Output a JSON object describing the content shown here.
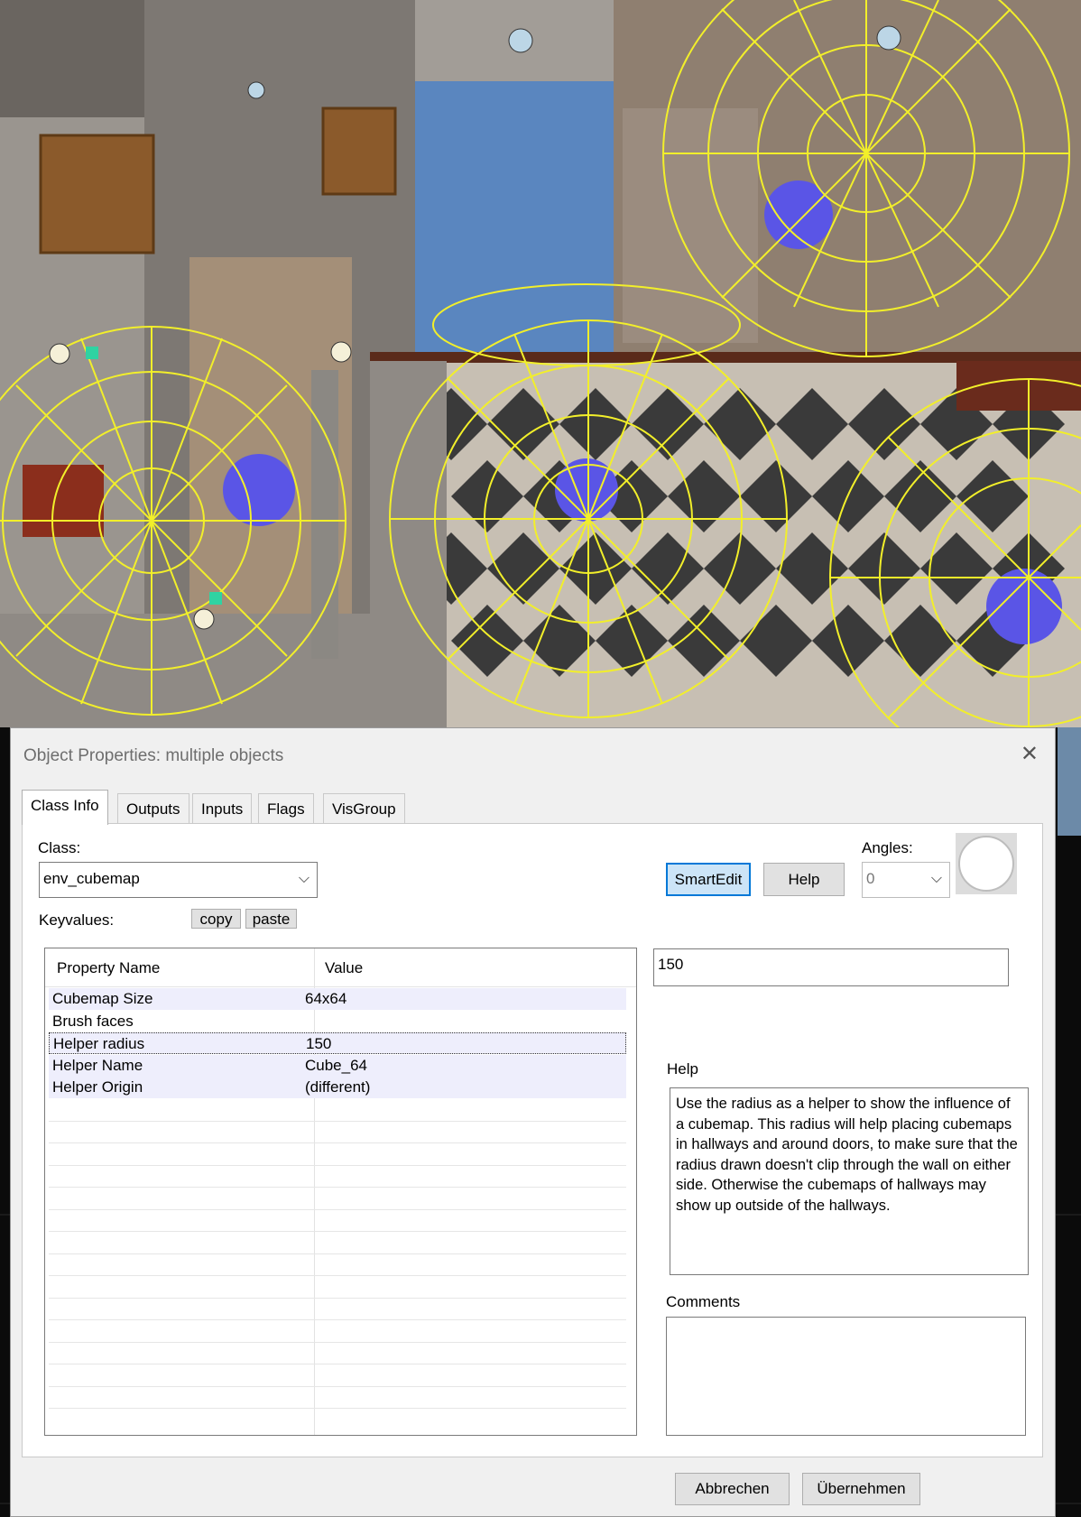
{
  "dialog": {
    "title": "Object Properties: multiple objects",
    "close_icon": "close-icon",
    "tabs": [
      {
        "label": "Class Info",
        "active": true
      },
      {
        "label": "Outputs",
        "active": false
      },
      {
        "label": "Inputs",
        "active": false
      },
      {
        "label": "Flags",
        "active": false
      },
      {
        "label": "VisGroup",
        "active": false
      }
    ],
    "class_label": "Class:",
    "class_value": "env_cubemap",
    "keyvalues_label": "Keyvalues:",
    "copy_label": "copy",
    "paste_label": "paste",
    "smartedit_label": "SmartEdit",
    "help_button_label": "Help",
    "angles_label": "Angles:",
    "angles_value": "0",
    "table": {
      "col_name": "Property Name",
      "col_value": "Value",
      "rows": [
        {
          "name": "Cubemap Size",
          "value": "64x64",
          "highlighted": true
        },
        {
          "name": "Brush faces",
          "value": "",
          "highlighted": false
        },
        {
          "name": "Helper radius",
          "value": "150",
          "highlighted": true,
          "focused": true
        },
        {
          "name": "Helper Name",
          "value": "Cube_64",
          "highlighted": true
        },
        {
          "name": "Helper Origin",
          "value": "(different)",
          "highlighted": true
        }
      ]
    },
    "value_input": "150",
    "help_title": "Help",
    "help_text": "Use the radius as a helper to show the influence of a cubemap. This radius will help placing cubemaps in hallways and around doors, to make sure that the radius drawn doesn't clip through the wall on either side. Otherwise the cubemaps of hallways may show up outside of the hallways.",
    "comments_label": "Comments",
    "comments_value": "",
    "cancel_label": "Abbrechen",
    "apply_label": "Übernehmen"
  },
  "colors": {
    "wireframe": "#f2ef2a",
    "sky": "#5a86bf",
    "cubemap_sphere": "#5a55e6",
    "focus_blue": "#0078d7"
  }
}
